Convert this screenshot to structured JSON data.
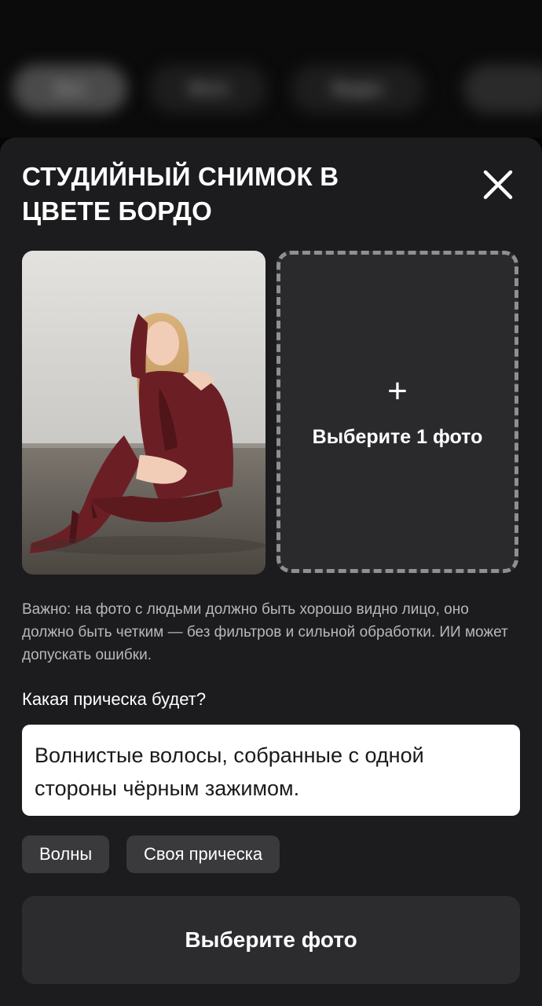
{
  "background_tabs": [
    "Все",
    "Фото",
    "Видео",
    ""
  ],
  "sheet": {
    "title": "СТУДИЙНЫЙ СНИМОК В ЦВЕТЕ БОРДО",
    "close_icon": "close-icon"
  },
  "upload": {
    "plus_icon": "+",
    "label": "Выберите 1 фото"
  },
  "note": "Важно: на фото с людьми должно быть хорошо видно лицо, оно должно быть четким — без фильтров и сильной обработки. ИИ может допускать ошибки.",
  "hairstyle": {
    "question": "Какая прическа будет?",
    "value": "Волнистые волосы, собранные с одной стороны чёрным зажимом.",
    "options": [
      "Волны",
      "Своя прическа"
    ]
  },
  "cta": {
    "label": "Выберите фото"
  },
  "colors": {
    "sheet_bg": "#1c1c1e",
    "chip_bg": "#3a3a3c",
    "cta_bg": "#2c2c2e",
    "upload_border": "#8e8e93",
    "outfit": "#6b1f24"
  }
}
